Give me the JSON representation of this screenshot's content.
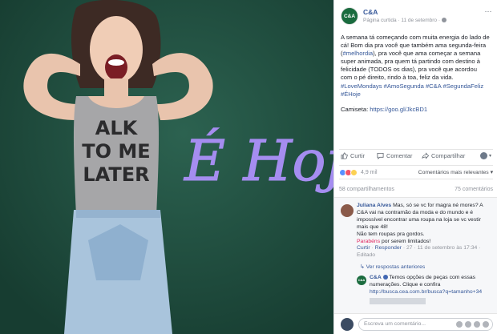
{
  "page": {
    "logo_text": "C&A",
    "name": "C&A",
    "meta": "Página curtida · 11 de setembro · ",
    "more_icon": "more-dots-icon"
  },
  "photo": {
    "shirt_lines": [
      "ALK",
      "TO ME",
      "LATER"
    ],
    "overlay_text": "É Hoje"
  },
  "post": {
    "para1_a": "A semana tá começando com muita energia do lado de cá! Bom dia pra você que também ama segunda-feira (",
    "para1_tag": "#melhordia",
    "para1_b": "), pra você que ama começar a semana super animada, pra quem tá partindo com destino à felicidade (TODOS os dias), pra você que acordou com o pé direito, rindo à toa, feliz da vida.",
    "hashtags": "#LoveMondays #AmoSegunda #C&A #SegundaFeliz #ÉHoje",
    "shirt_label": "Camiseta: ",
    "shirt_link": "https://goo.gl/JkcBD1"
  },
  "actions": {
    "like": "Curtir",
    "comment": "Comentar",
    "share": "Compartilhar"
  },
  "reactions": {
    "count": "4,9 mil",
    "sort": "Comentários mais relevantes ▾"
  },
  "counts": {
    "shares": "58 compartilhamentos",
    "comments": "75 comentários"
  },
  "comment1": {
    "author": "Juliana Alves",
    "text": " Mas, só se vc for magra né mores? A C&A vai na contramão da moda e do mundo e é impossível encontrar uma roupa na loja se vc vestir mais que 48!",
    "text2": "Não tem roupas pra gordos.",
    "red": "Parabéns",
    "text3": " por serem limitados!",
    "meta_like": "Curtir",
    "meta_reply": "Responder",
    "meta_count": "27",
    "meta_date": "11 de setembro às 17:34",
    "meta_edited": "Editado"
  },
  "replies_link": "↳ Ver respostas anteriores",
  "reply1": {
    "author": "C&A",
    "logo_text": "C&A",
    "text": " Temos opções de peças com essas numerações. Clique e confira",
    "link": "http://busca.cea.com.br/busca?q=tamanho+34"
  },
  "composer": {
    "placeholder": "Escreva um comentário..."
  }
}
